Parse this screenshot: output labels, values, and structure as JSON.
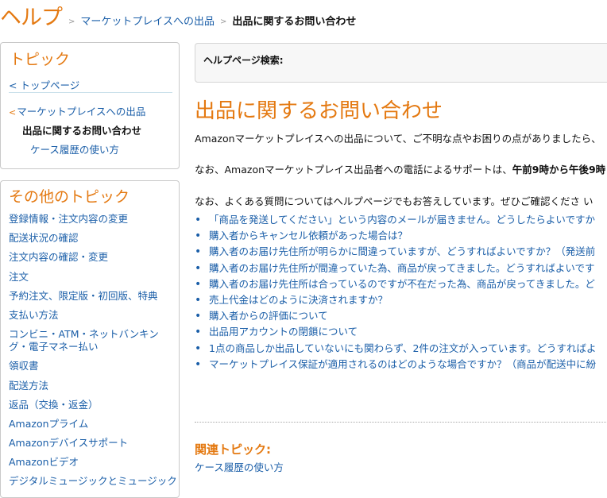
{
  "header": {
    "logo": "ヘルプ",
    "breadcrumb": {
      "sep1": ">",
      "item1": "マーケットプレイスへの出品",
      "sep2": ">",
      "current": "出品に関するお問い合わせ"
    }
  },
  "sidebar_topic": {
    "title": "トピック",
    "top_link": "< トップページ",
    "arrow": "<",
    "parent": "マーケットプレイスへの出品",
    "current": "出品に関するお問い合わせ",
    "child": "ケース履歴の使い方"
  },
  "sidebar_other": {
    "title": "その他のトピック",
    "items": [
      "登録情報・注文内容の変更",
      "配送状況の確認",
      "注文内容の確認・変更",
      "注文",
      "予約注文、限定版・初回版、特典",
      "支払い方法",
      "コンビニ・ATM・ネットバンキング・電子マネー払い",
      "領収書",
      "配送方法",
      "返品（交換・返金）",
      "Amazonプライム",
      "Amazonデバイスサポート",
      "Amazonビデオ",
      "デジタルミュージックとミュージック"
    ]
  },
  "search": {
    "label": "ヘルプページ検索:"
  },
  "main": {
    "title": "出品に関するお問い合わせ",
    "para1": "Amazonマーケットプレイスへの出品について、ご不明な点やお困りの点がありましたら、",
    "para2_prefix": "なお、Amazonマーケットプレイス出品者への電話によるサポートは、",
    "para2_bold": "午前9時から午後9時",
    "para3": "なお、よくある質問についてはヘルプページでもお答えしています。ぜひご確認くださ い",
    "bullet": "•",
    "faq": [
      "「商品を発送してください」という内容のメールが届きません。どうしたらよいですか",
      "購入者からキャンセル依頼があった場合は？",
      "購入者のお届け先住所が明らかに間違っていますが、どうすればよいですか？（発送前",
      "購入者のお届け先住所が間違っていた為、商品が戻ってきました。どうすればよいです",
      "購入者のお届け先住所は合っているのですが不在だった為、商品が戻ってきました。ど",
      "売上代金はどのように決済されますか？",
      "購入者からの評価について",
      "出品用アカウントの閉鎖について",
      "1点の商品しか出品していないにも関わらず、2件の注文が入っています。どうすればよ",
      "マーケットプレイス保証が適用されるのはどのような場合ですか？（商品が配送中に紛"
    ],
    "related_heading": "関連トピック:",
    "related_link": "ケース履歴の使い方"
  }
}
